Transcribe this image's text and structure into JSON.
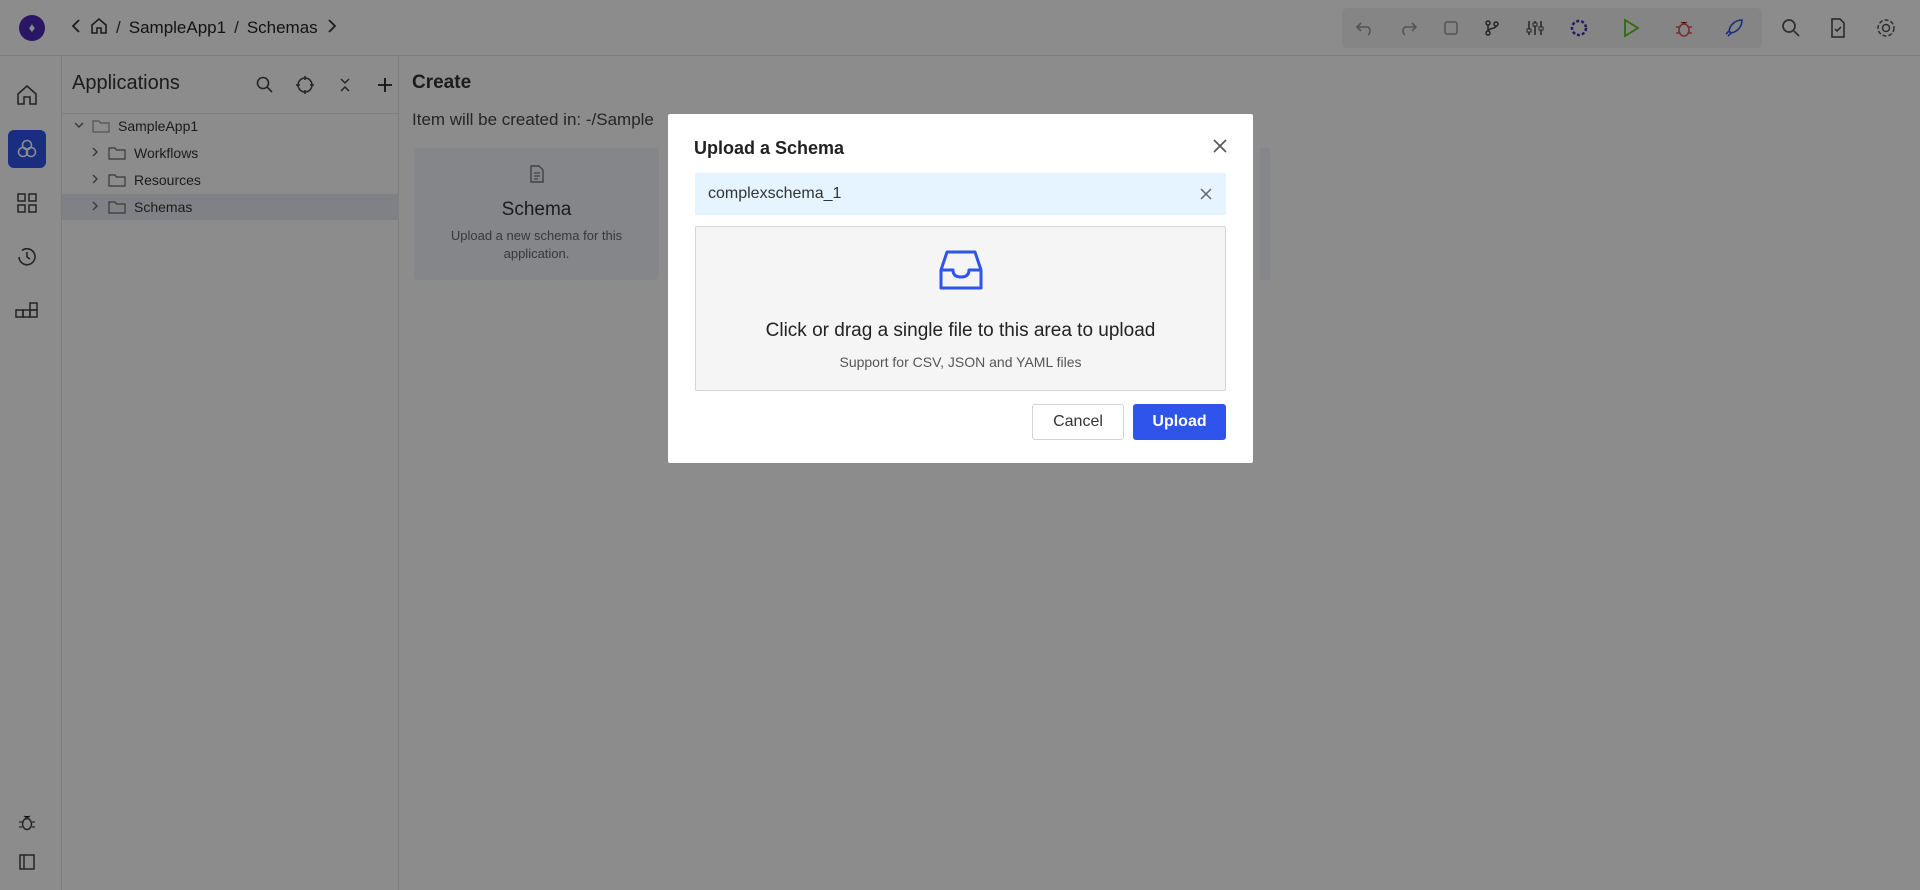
{
  "header": {
    "logo_glyph": "♦",
    "breadcrumb": {
      "app": "SampleApp1",
      "section": "Schemas",
      "separator": "/"
    },
    "toolbar_icons": [
      "undo-icon",
      "redo-icon",
      "note-icon",
      "branch-icon",
      "sliders-icon",
      "spinner-icon",
      "play-icon",
      "bug-icon",
      "rocket-icon",
      "search-icon",
      "file-check-icon",
      "gear-icon"
    ],
    "colors": {
      "play": "#52c41a",
      "bug": "#e05252",
      "rocket": "#2f54eb",
      "spinner": "#4b2bb8"
    }
  },
  "rail": {
    "items": [
      "home-icon",
      "apps-icon",
      "grid-icon",
      "history-icon",
      "modules-icon"
    ],
    "active": "apps-icon",
    "bottom_items": [
      "bug-icon",
      "panel-icon"
    ]
  },
  "explorer": {
    "title": "Applications",
    "tree": [
      {
        "label": "SampleApp1",
        "expanded": true,
        "level": 0
      },
      {
        "label": "Workflows",
        "expanded": false,
        "level": 1
      },
      {
        "label": "Resources",
        "expanded": false,
        "level": 1
      },
      {
        "label": "Schemas",
        "expanded": false,
        "level": 1,
        "selected": true
      }
    ]
  },
  "main": {
    "title": "Create",
    "path_text": "Item will be created in: -/Sample",
    "card": {
      "title": "Schema",
      "description": "Upload a new schema for this application."
    }
  },
  "modal": {
    "title": "Upload a Schema",
    "file_name": "complexschema_1",
    "dropzone_text": "Click or drag a single file to this area to upload",
    "dropzone_hint": "Support for CSV, JSON and YAML files",
    "cancel_label": "Cancel",
    "upload_label": "Upload",
    "accent_color": "#2f54eb",
    "file_row_color": "#e6f4ff"
  }
}
